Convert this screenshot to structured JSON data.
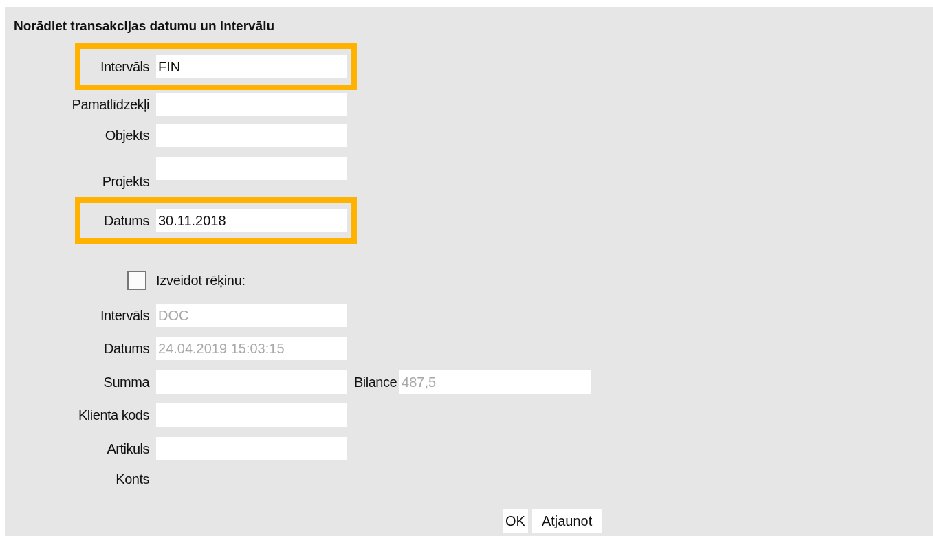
{
  "title": "Norādiet transakcijas datumu un intervālu",
  "rows": [
    {
      "kind": "field",
      "label": "Intervāls",
      "value": "FIN",
      "highlighted": true,
      "disabled": false
    },
    {
      "kind": "field",
      "label": "Pamatlīdzekļi",
      "highlighted": false
    },
    {
      "kind": "field",
      "label": "Objekts",
      "highlighted": false
    },
    {
      "kind": "field",
      "label": "Projekts",
      "highlighted": false
    },
    {
      "kind": "field",
      "label": "Datums",
      "value": "30.11.2018",
      "highlighted": true,
      "disabled": false
    },
    {
      "kind": "checkbox",
      "label": "Izveidot rēķinu:",
      "checked": false
    },
    {
      "kind": "field",
      "label": "Intervāls",
      "value": "DOC",
      "highlighted": false,
      "disabled": true
    },
    {
      "kind": "field",
      "label": "Datums",
      "value": "24.04.2019 15:03:15",
      "highlighted": false,
      "disabled": true
    },
    {
      "kind": "field",
      "label": "Summa",
      "highlighted": false,
      "extra": {
        "label": "Bilance",
        "value": "487,5",
        "disabled": true
      }
    },
    {
      "kind": "field",
      "label": "Klienta kods",
      "highlighted": false
    },
    {
      "kind": "field",
      "label": "Artikuls",
      "highlighted": false
    },
    {
      "kind": "text",
      "label": "Konts"
    }
  ],
  "buttons": [
    {
      "label": "OK"
    },
    {
      "label": "Atjaunot"
    }
  ]
}
